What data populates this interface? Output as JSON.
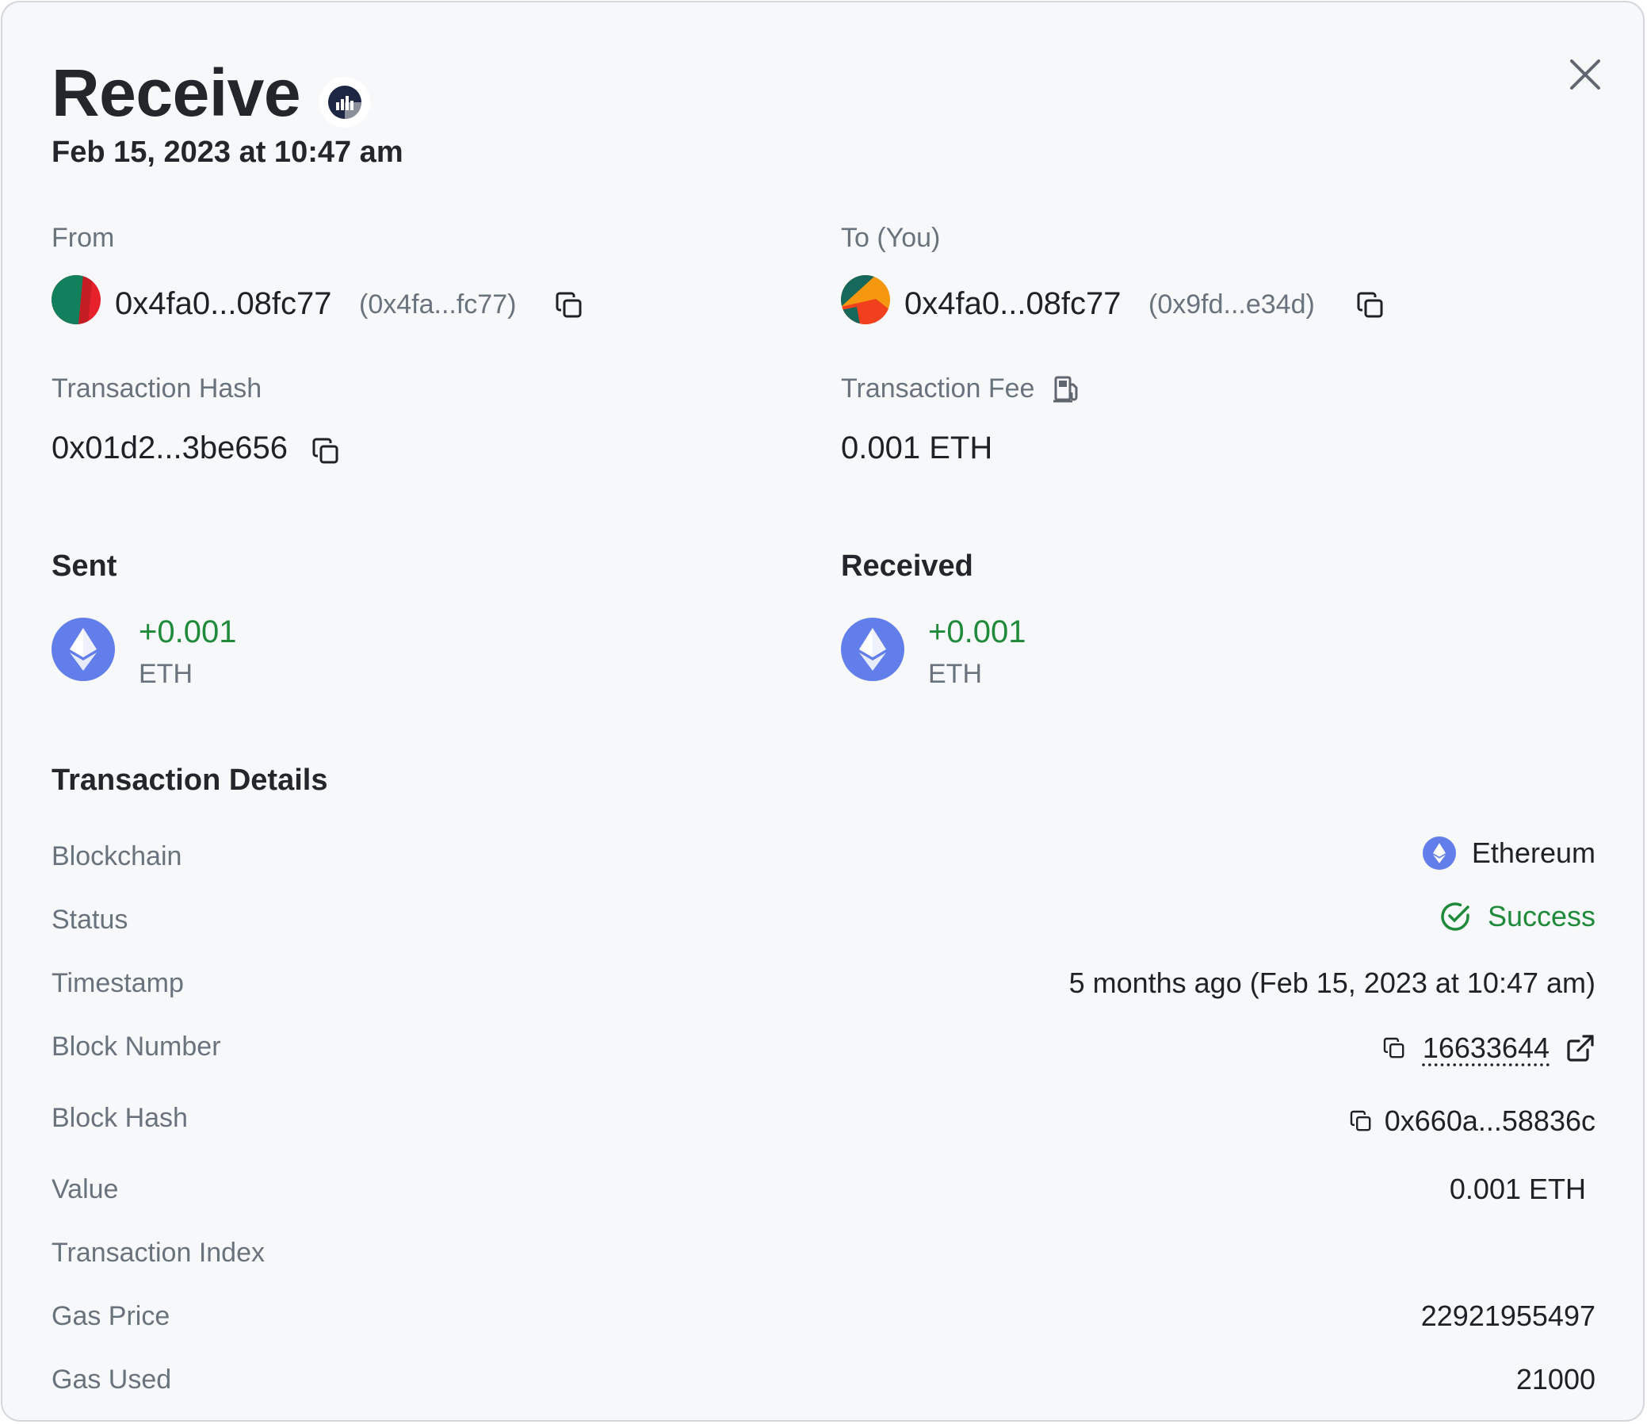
{
  "header": {
    "title": "Receive",
    "date": "Feb 15, 2023 at 10:47 am",
    "title_badge_icon": "chart-bars-icon",
    "close_icon": "close-icon"
  },
  "from": {
    "label": "From",
    "address": "0x4fa0...08fc77",
    "short": "(0x4fa...fc77)"
  },
  "to": {
    "label": "To (You)",
    "address": "0x4fa0...08fc77",
    "short": "(0x9fd...e34d)"
  },
  "hash": {
    "label": "Transaction Hash",
    "value": "0x01d2...3be656"
  },
  "fee": {
    "label": "Transaction Fee",
    "value": "0.001 ETH",
    "icon": "gas-pump-icon"
  },
  "sent": {
    "heading": "Sent",
    "amount": "+0.001",
    "unit": "ETH"
  },
  "received": {
    "heading": "Received",
    "amount": "+0.001",
    "unit": "ETH"
  },
  "details": {
    "heading": "Transaction Details",
    "blockchain": {
      "label": "Blockchain",
      "value": "Ethereum"
    },
    "status": {
      "label": "Status",
      "value": "Success"
    },
    "timestamp": {
      "label": "Timestamp",
      "value": "5 months ago (Feb 15, 2023 at 10:47 am)"
    },
    "block_number": {
      "label": "Block Number",
      "value": "16633644"
    },
    "block_hash": {
      "label": "Block Hash",
      "value": "0x660a...58836c"
    },
    "value": {
      "label": "Value",
      "value": "0.001 ETH"
    },
    "tx_index": {
      "label": "Transaction Index",
      "value": ""
    },
    "gas_price": {
      "label": "Gas Price",
      "value": "22921955497"
    },
    "gas_used": {
      "label": "Gas Used",
      "value": "21000"
    }
  },
  "colors": {
    "accent_eth": "#627eea",
    "success": "#1e8a3a",
    "muted": "#6a737d",
    "panel_bg": "#f7f8fa"
  }
}
